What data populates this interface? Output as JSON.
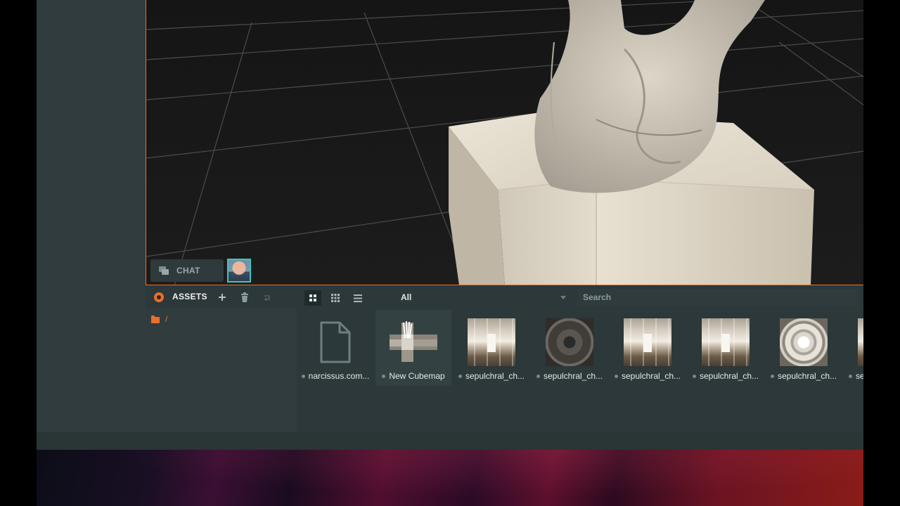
{
  "viewport": {
    "chat": {
      "label": "CHAT"
    },
    "accent_color": "#e8702a"
  },
  "assets": {
    "title": "ASSETS",
    "toolbar": {
      "add_icon": "plus-icon",
      "delete_icon": "trash-icon",
      "extra_icon": "reply-icon",
      "view_modes": [
        "large-grid",
        "small-grid",
        "list"
      ],
      "active_view": "large-grid"
    },
    "filter": {
      "value": "All"
    },
    "search": {
      "placeholder": "Search"
    },
    "folder": {
      "path": "/"
    },
    "items": [
      {
        "label": "narcissus.com...",
        "thumb": "file-icon"
      },
      {
        "label": "New Cubemap",
        "thumb": "cubemap",
        "selected": true
      },
      {
        "label": "sepulchral_ch...",
        "thumb": "hall"
      },
      {
        "label": "sepulchral_ch...",
        "thumb": "circle"
      },
      {
        "label": "sepulchral_ch...",
        "thumb": "hall"
      },
      {
        "label": "sepulchral_ch...",
        "thumb": "hall"
      },
      {
        "label": "sepulchral_ch...",
        "thumb": "dome"
      },
      {
        "label": "se",
        "thumb": "hall"
      }
    ]
  }
}
